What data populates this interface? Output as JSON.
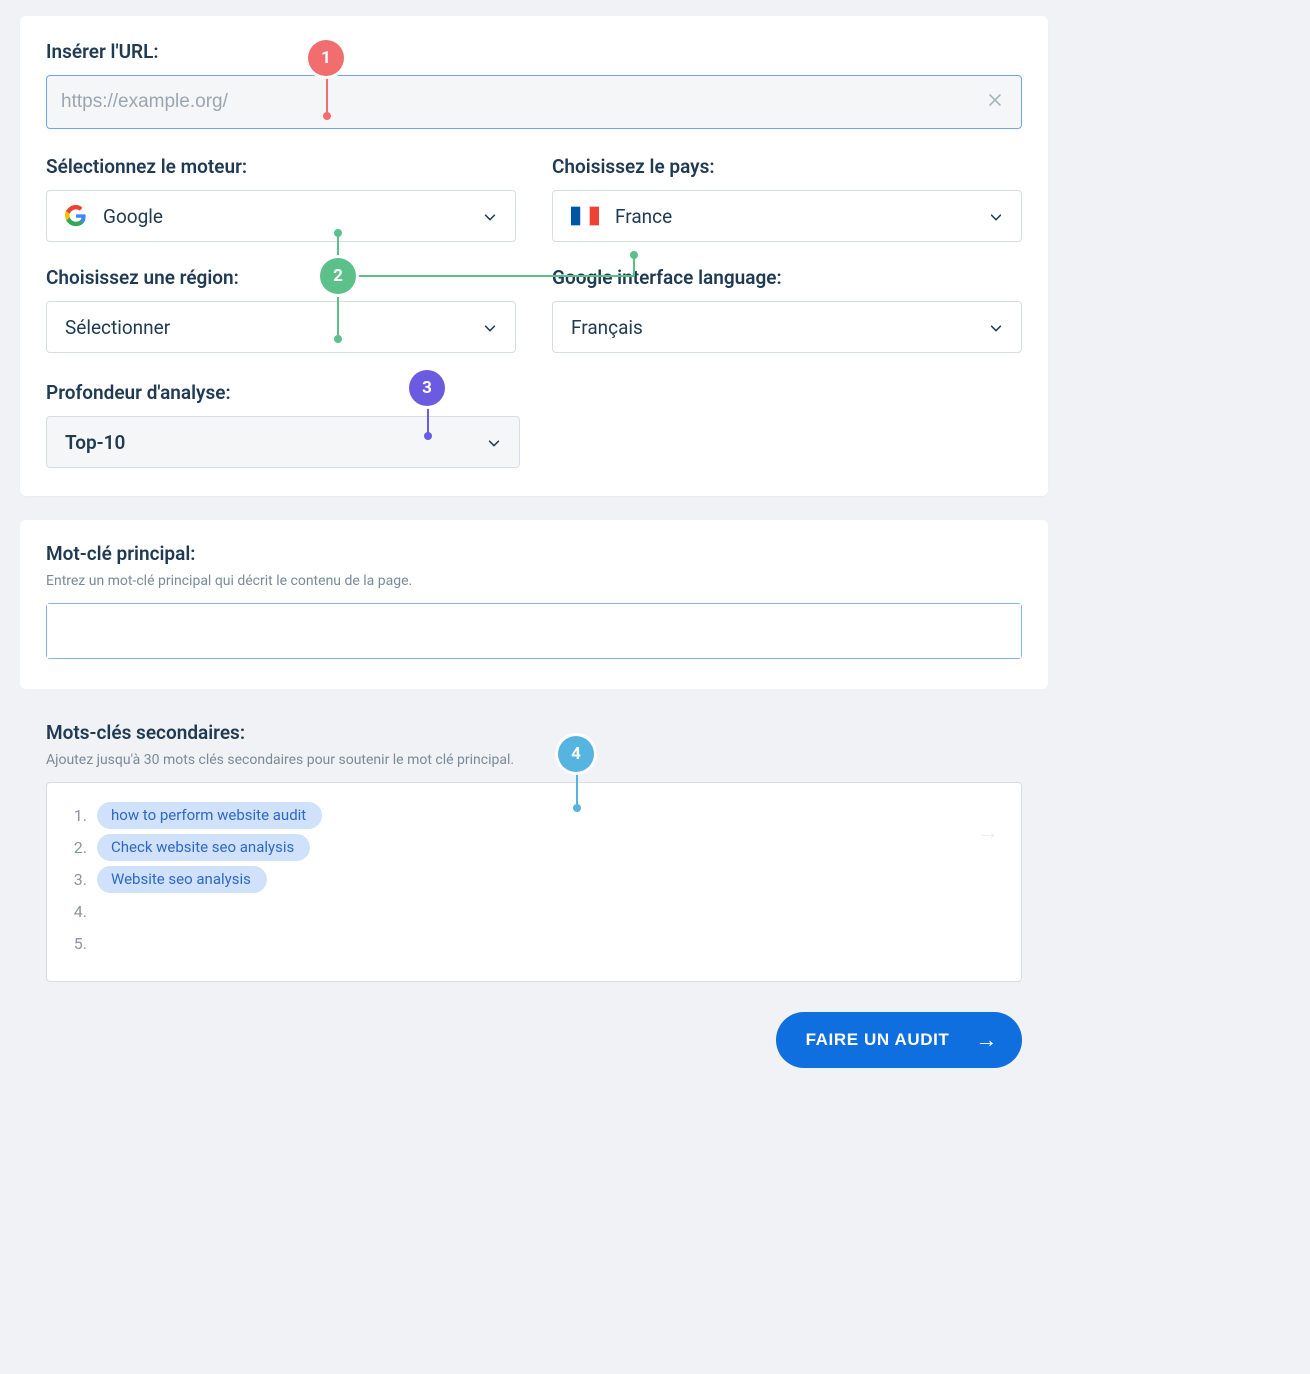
{
  "url": {
    "label": "Insérer l'URL:",
    "placeholder": "https://example.org/"
  },
  "engine": {
    "label": "Sélectionnez le moteur:",
    "value": "Google"
  },
  "country": {
    "label": "Choisissez le pays:",
    "value": "France"
  },
  "region": {
    "label": "Choisissez une région:",
    "value": "Sélectionner"
  },
  "ilang": {
    "label": "Google interface language:",
    "value": "Français"
  },
  "depth": {
    "label": "Profondeur d'analyse:",
    "value": "Top-10"
  },
  "primary": {
    "label": "Mot-clé principal:",
    "hint": "Entrez un mot-clé principal qui décrit le contenu de la page."
  },
  "secondary": {
    "label": "Mots-clés secondaires:",
    "hint": "Ajoutez jusqu'à 30 mots clés secondaires pour soutenir le mot clé principal.",
    "items": [
      "how to perform website audit",
      "Check website seo analysis",
      "Website seo analysis"
    ],
    "nums": [
      "1.",
      "2.",
      "3.",
      "4.",
      "5."
    ]
  },
  "cta": {
    "label": "FAIRE UN AUDIT"
  },
  "markers": {
    "m1": "1",
    "m2": "2",
    "m3": "3",
    "m4": "4"
  }
}
